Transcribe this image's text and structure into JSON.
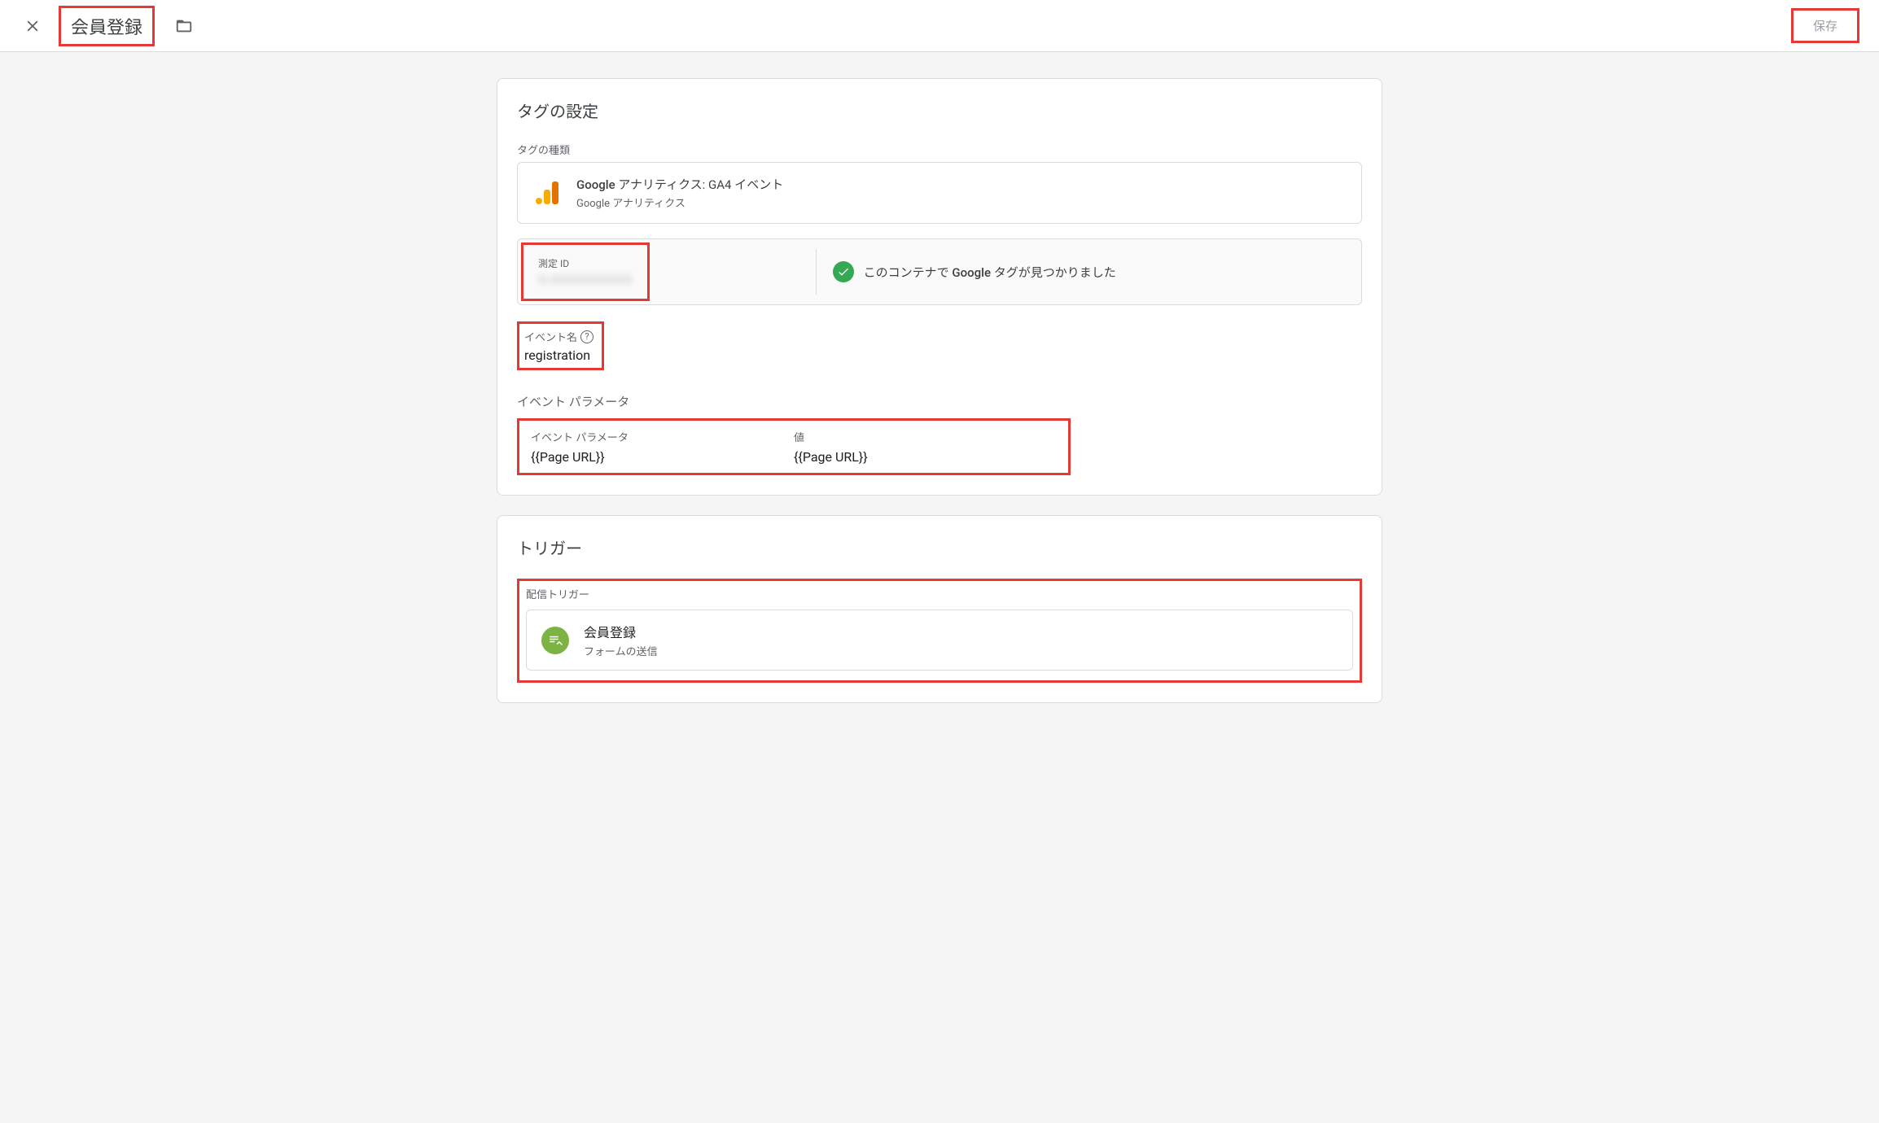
{
  "header": {
    "title": "会員登録",
    "save_label": "保存"
  },
  "tag_config": {
    "card_title": "タグの設定",
    "type_label": "タグの種類",
    "type_name_prefix": "Google",
    "type_name_rest": " アナリティクス: GA4 イベント",
    "type_subtitle": "Google アナリティクス",
    "measurement_label": "測定 ID",
    "measurement_value": "G-XXXXXXXXXX",
    "found_text_pre": "このコンテナで ",
    "found_text_bold": "Google",
    "found_text_post": " タグが見つかりました",
    "event_name_label": "イベント名",
    "event_name_value": "registration",
    "params_section_label": "イベント パラメータ",
    "param_header_key": "イベント パラメータ",
    "param_header_val": "値",
    "param_key": "{{Page URL}}",
    "param_val": "{{Page URL}}"
  },
  "trigger": {
    "card_title": "トリガー",
    "section_label": "配信トリガー",
    "name": "会員登録",
    "type": "フォームの送信"
  }
}
